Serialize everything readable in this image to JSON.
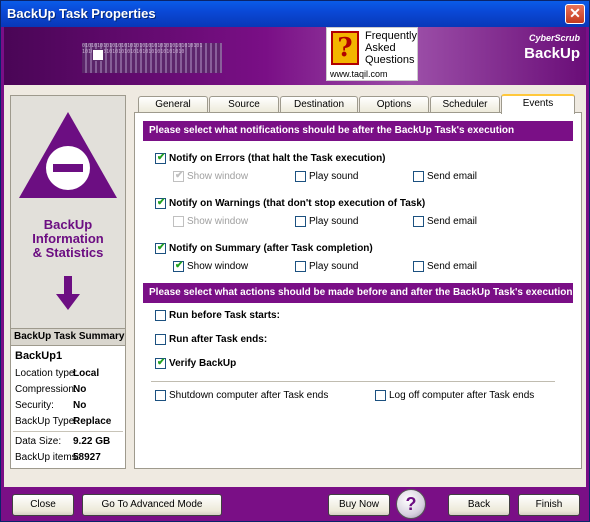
{
  "window": {
    "title": "BackUp Task Properties"
  },
  "banner": {
    "faq": {
      "q_glyph": "?",
      "line1": "Frequently",
      "line2": "Asked",
      "line3": "Questions",
      "url": "www.taqil.com"
    },
    "brand_small": "CyberScrub",
    "brand_big": "BackUp",
    "binary_text": "0101010101010101010101010101010101010101 1010101010101010101010101010101010"
  },
  "sidebar": {
    "title_line1": "BackUp",
    "title_line2": "Information",
    "title_line3": "& Statistics",
    "summary_header": "BackUp Task Summary",
    "task_name": "BackUp1",
    "rows": [
      {
        "label": "Location type:",
        "value": "Local"
      },
      {
        "label": "Compression:",
        "value": "No"
      },
      {
        "label": "Security:",
        "value": "No"
      },
      {
        "label": "BackUp Type:",
        "value": "Replace"
      },
      {
        "label": "Data Size:",
        "value": "9.22 GB"
      },
      {
        "label": "BackUp items:",
        "value": "58927"
      }
    ]
  },
  "tabs": [
    "General",
    "Source",
    "Destination",
    "Options",
    "Scheduler",
    "Events"
  ],
  "active_tab": "Events",
  "events": {
    "notifications_header": "Please select what notifications should be after the BackUp Task's execution",
    "groups": [
      {
        "label": "Notify on Errors  (that halt the Task execution)",
        "checked": true,
        "show_window": "Show window",
        "show_window_checked": true,
        "show_window_disabled": true,
        "play_sound": "Play sound",
        "play_sound_checked": false,
        "send_email": "Send email",
        "send_email_checked": false
      },
      {
        "label": "Notify on Warnings  (that don't stop execution of Task)",
        "checked": true,
        "show_window": "Show window",
        "show_window_checked": false,
        "show_window_disabled": true,
        "play_sound": "Play sound",
        "play_sound_checked": false,
        "send_email": "Send email",
        "send_email_checked": false
      },
      {
        "label": "Notify on Summary  (after Task completion)",
        "checked": true,
        "show_window": "Show window",
        "show_window_checked": true,
        "show_window_disabled": false,
        "play_sound": "Play sound",
        "play_sound_checked": false,
        "send_email": "Send email",
        "send_email_checked": false
      }
    ],
    "actions_header": "Please select what actions should be made before and after the BackUp Task's execution",
    "run_before": "Run before Task starts:",
    "run_after": "Run after Task ends:",
    "verify": "Verify BackUp",
    "shutdown": "Shutdown computer after Task ends",
    "logoff": "Log off computer after Task ends"
  },
  "footer": {
    "close": "Close",
    "advanced": "Go To Advanced Mode",
    "buy": "Buy Now",
    "help": "?",
    "back": "Back",
    "finish": "Finish"
  },
  "colors": {
    "accent": "#7a0f86",
    "title_bar": "#0a48d6",
    "check": "#21a121"
  }
}
